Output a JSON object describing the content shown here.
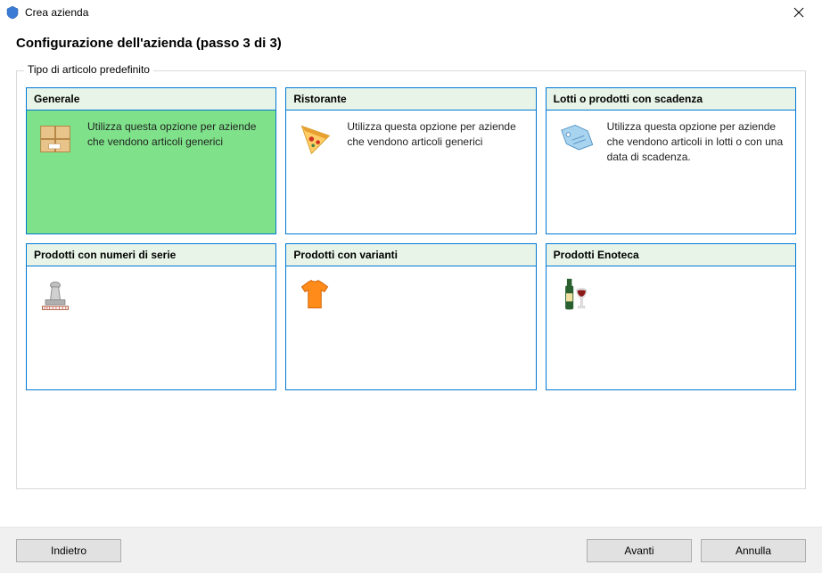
{
  "window": {
    "title": "Crea azienda"
  },
  "header": {
    "title": "Configurazione dell'azienda (passo 3 di 3)"
  },
  "fieldset": {
    "legend": "Tipo di articolo predefinito"
  },
  "cards": {
    "generale": {
      "title": "Generale",
      "desc": "Utilizza questa opzione per aziende che vendono articoli generici"
    },
    "ristorante": {
      "title": "Ristorante",
      "desc": "Utilizza questa opzione per aziende che vendono articoli generici"
    },
    "lotti": {
      "title": "Lotti o prodotti con scadenza",
      "desc": "Utilizza questa opzione per aziende che vendono articoli in lotti o con una data di scadenza."
    },
    "seriali": {
      "title": "Prodotti con numeri di serie",
      "desc": ""
    },
    "varianti": {
      "title": "Prodotti con varianti",
      "desc": ""
    },
    "enoteca": {
      "title": "Prodotti Enoteca",
      "desc": ""
    }
  },
  "buttons": {
    "back": "Indietro",
    "next": "Avanti",
    "cancel": "Annulla"
  }
}
